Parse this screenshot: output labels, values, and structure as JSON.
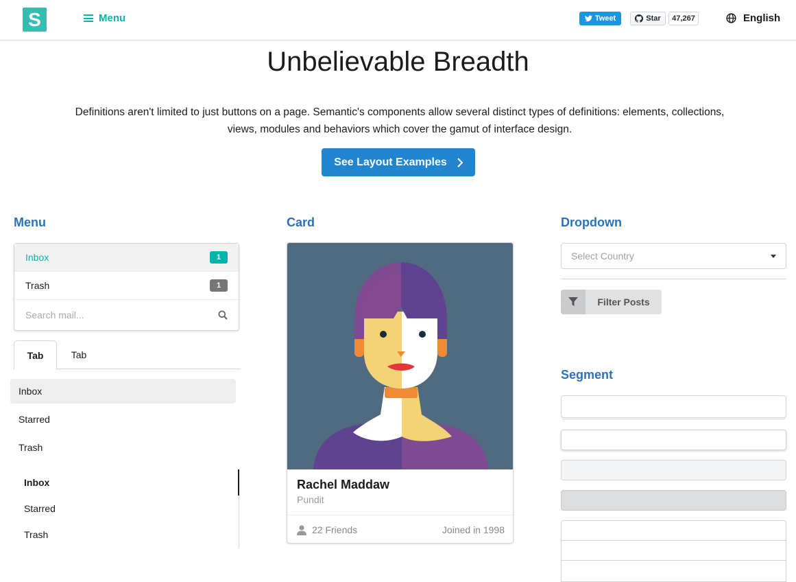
{
  "nav": {
    "logo_letter": "S",
    "menu_label": "Menu",
    "tweet_label": "Tweet",
    "star_label": "Star",
    "star_count": "47,267",
    "language": "English"
  },
  "hero": {
    "title": "Unbelievable Breadth",
    "description": "Definitions aren't limited to just buttons on a page. Semantic's components allow several distinct types of definitions: elements, collections, views, modules and behaviors which cover the gamut of interface design.",
    "cta_label": "See Layout Examples"
  },
  "menu_section": {
    "heading": "Menu",
    "items": [
      {
        "label": "Inbox",
        "count": "1"
      },
      {
        "label": "Trash",
        "count": "1"
      }
    ],
    "search_placeholder": "Search mail...",
    "tabs": [
      "Tab",
      "Tab"
    ],
    "secondary_items": [
      "Inbox",
      "Starred",
      "Trash"
    ],
    "tabular_items": [
      "Inbox",
      "Starred",
      "Trash"
    ]
  },
  "card_section": {
    "heading": "Card",
    "name": "Rachel Maddaw",
    "meta": "Pundit",
    "friends": "22 Friends",
    "joined": "Joined in 1998"
  },
  "dropdown_section": {
    "heading": "Dropdown",
    "placeholder": "Select Country",
    "filter_label": "Filter Posts"
  },
  "segment_section": {
    "heading": "Segment"
  },
  "colors": {
    "teal": "#00b5ad",
    "blue": "#2185d0",
    "heading_blue": "#2c72b8",
    "twitter": "#1b95e0"
  }
}
